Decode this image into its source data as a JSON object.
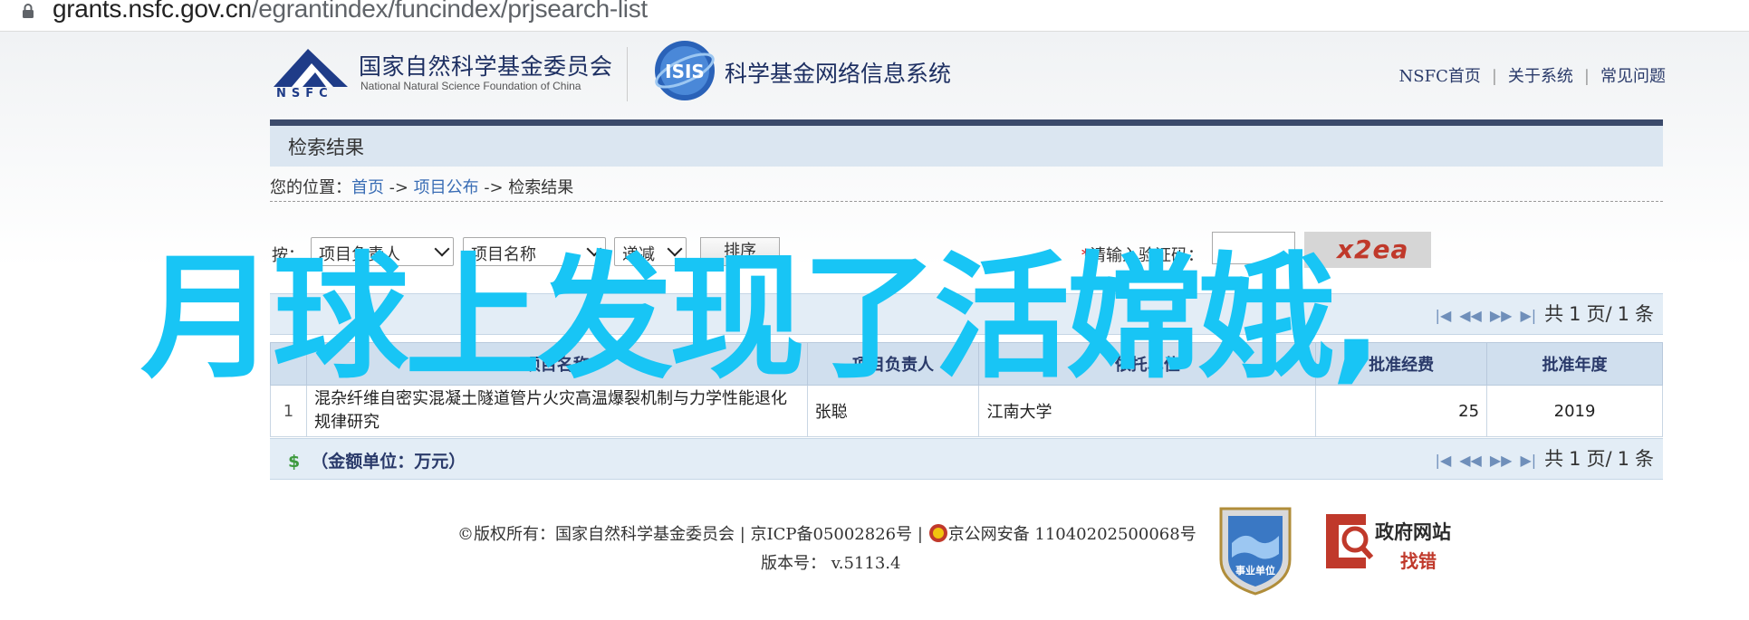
{
  "browser": {
    "url_host": "grants.nsfc.gov.cn",
    "url_path": "/egrantindex/funcindex/prjsearch-list"
  },
  "header": {
    "org_name_cn": "国家自然科学基金委员会",
    "org_name_en": "National Natural Science Foundation of China",
    "nsfc_letters": "NSFC",
    "system_title": "科学基金网络信息系统",
    "nav": [
      "NSFC首页",
      "关于系统",
      "常见问题"
    ],
    "nav_sep": "|"
  },
  "section": {
    "title": "检索结果",
    "breadcrumb_prefix": "您的位置：",
    "breadcrumb": [
      "首页",
      "项目公布",
      "检索结果"
    ],
    "breadcrumb_sep": "->"
  },
  "sort": {
    "label": "按：",
    "field1": "项目负责人",
    "field2": "项目名称",
    "order": "递减",
    "button": "排序",
    "captcha_required_mark": "*",
    "captcha_label": "请输入验证码：",
    "captcha_value": "",
    "captcha_image_text": "x2ea"
  },
  "pager": {
    "prefix": "共",
    "current": "1",
    "middle": "页/",
    "total": "1",
    "suffix": "条"
  },
  "table": {
    "columns": [
      "",
      "项目名称",
      "项目负责人",
      "依托单位",
      "批准经费",
      "批准年度"
    ],
    "rows": [
      [
        "1",
        "混杂纤维自密实混凝土隧道管片火灾高温爆裂机制与力学性能退化规律研究",
        "张聪",
        "江南大学",
        "25",
        "2019"
      ]
    ]
  },
  "footer_unit": "（金额单位：万元）",
  "footer": {
    "copyright": "©版权所有：国家自然科学基金委员会 | 京ICP备05002826号 |",
    "police": "京公网安备 11040202500068号",
    "version": "版本号： v.5113.4",
    "gov_site_line1": "政府网站",
    "gov_site_line2": "找错",
    "shield_text": "事业单位"
  },
  "overlay_text": "月球上发现了活嫦娥,",
  "colors": {
    "accent_dark": "#3b4a6b",
    "bar_light": "#dbe6f1",
    "overlay": "#18c5f5",
    "link": "#3a6db5"
  }
}
